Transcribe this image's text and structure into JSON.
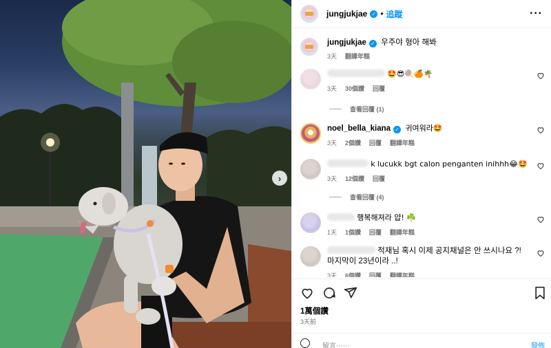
{
  "post": {
    "username": "jungjukjae",
    "follow_label": "追蹤",
    "separator": "•",
    "caption": "우주야 형아 해봐",
    "caption_time": "3天",
    "caption_translate": "翻譯年糕"
  },
  "comments": [
    {
      "text": "🤩😎🍭🍊🌴",
      "time": "3天",
      "likes": "30個讚",
      "reply": "回覆",
      "view_replies": "查看回覆 (1)"
    },
    {
      "username": "noel_bella_kiana",
      "text": "귀여워라🤩",
      "time": "3天",
      "likes": "2個讚",
      "reply": "回覆",
      "translate": "翻譯年糕"
    },
    {
      "text": "k lucukk bgt calon penganten inihhh😂🤩",
      "time": "3天",
      "likes": "12個讚",
      "reply": "回覆",
      "view_replies": "查看回覆 (4)"
    },
    {
      "text": "행복해져라 얍! ☘️",
      "time": "1天",
      "likes": "1個讚",
      "reply": "回覆",
      "translate": "翻譯年糕"
    },
    {
      "text": "적재님 혹시 이제 공지채널은 안 쓰시나요 ?! 마지막이 23년이라 ..!",
      "time": "3天",
      "likes": "6個讚",
      "reply": "回覆",
      "translate": "翻譯年糕"
    }
  ],
  "stats": {
    "likes": "1萬個讚",
    "date": "3天前"
  },
  "composer": {
    "placeholder": "留言⋯⋯",
    "post_label": "發佈"
  },
  "icons": [
    "heart-icon",
    "comment-icon",
    "share-icon",
    "bookmark-icon",
    "more-icon",
    "verified-icon",
    "emoji-icon",
    "chevron-right-icon"
  ],
  "colors": {
    "accent": "#0095f6",
    "muted": "#737373",
    "border": "#efefef"
  }
}
